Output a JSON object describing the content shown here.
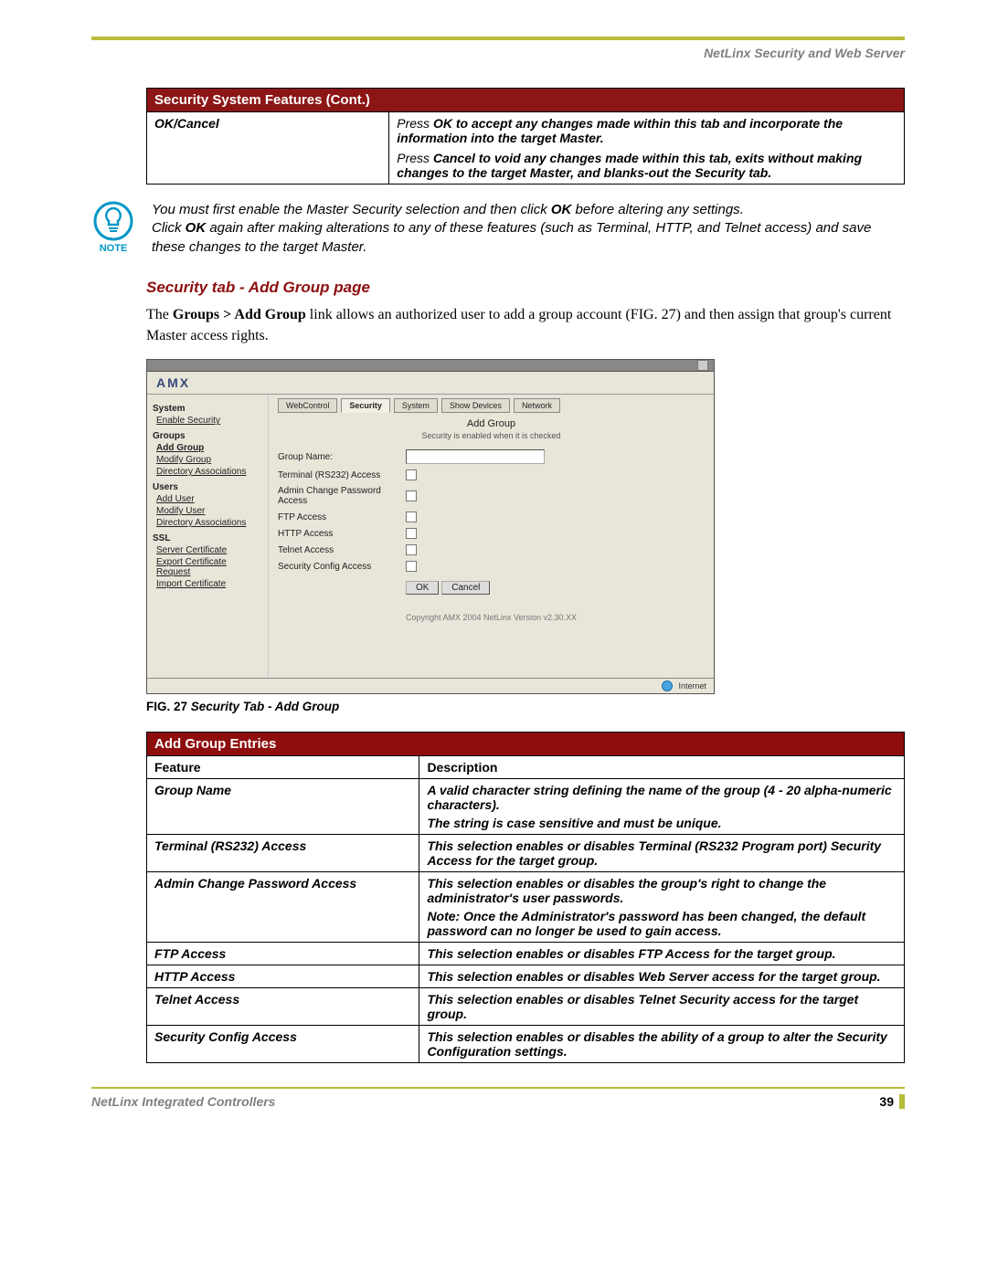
{
  "header": {
    "title": "NetLinx Security and Web Server"
  },
  "table1": {
    "title": "Security System Features (Cont.)",
    "row_label": "OK/Cancel",
    "desc1_prefix": "Press ",
    "desc1_bold": "OK",
    "desc1_rest": " to accept any changes made within this tab and incorporate the information into the target Master.",
    "desc2_prefix": "Press ",
    "desc2_bold": "Cancel",
    "desc2_rest": " to void any changes made within this tab, exits without making changes to the target Master, and blanks-out the Security tab."
  },
  "note": {
    "label": "NOTE",
    "line1a": "You must first enable the Master Security selection and then click ",
    "line1b": "OK",
    "line1c": " before altering any settings.",
    "line2a": "Click ",
    "line2b": "OK",
    "line2c": " again after making alterations to any of these features (such as Terminal, HTTP, and Telnet access) and save these changes to the target Master."
  },
  "subhead": "Security tab - Add Group page",
  "para": {
    "a": "The ",
    "b": "Groups > Add Group",
    "c": " link allows an authorized user to add a group account (FIG. 27) and then assign that group's current Master access rights."
  },
  "shot": {
    "logo": "AMX",
    "tabs": [
      "WebControl",
      "Security",
      "System",
      "Show Devices",
      "Network"
    ],
    "side": {
      "s_system": "System",
      "s_enable": "Enable Security",
      "s_groups": "Groups",
      "s_addg": "Add Group",
      "s_modg": "Modify Group",
      "s_dir1": "Directory Associations",
      "s_users": "Users",
      "s_addu": "Add User",
      "s_modu": "Modify User",
      "s_dir2": "Directory Associations",
      "s_ssl": "SSL",
      "s_sc": "Server Certificate",
      "s_ecr": "Export Certificate Request",
      "s_ic": "Import Certificate"
    },
    "main": {
      "title": "Add Group",
      "sub": "Security is enabled when it is checked",
      "rows": [
        "Group Name:",
        "Terminal (RS232) Access",
        "Admin Change Password Access",
        "FTP Access",
        "HTTP Access",
        "Telnet Access",
        "Security Config Access"
      ],
      "ok": "OK",
      "cancel": "Cancel",
      "copy": "Copyright AMX 2004   NetLinx Version v2.30.XX"
    },
    "status": "Internet"
  },
  "figcap": {
    "a": "FIG. 27",
    "b": "  Security Tab - Add Group"
  },
  "table2": {
    "title": "Add Group Entries",
    "h1": "Feature",
    "h2": "Description",
    "rows": [
      {
        "f": "Group Name",
        "d": "A valid character string defining the name of the group (4 - 20 alpha-numeric characters).",
        "d2": "The string is case sensitive and must be unique."
      },
      {
        "f": "Terminal (RS232) Access",
        "d": "This selection enables or disables Terminal (RS232 Program port) Security Access for the target group."
      },
      {
        "f": "Admin Change Password Access",
        "d": "This selection enables or disables the group's right to change the administrator's user passwords.",
        "d2": "Note: Once the Administrator's password has been changed, the default password can no longer be used to gain access."
      },
      {
        "f": "FTP Access",
        "d": "This selection enables or disables FTP Access for the target group."
      },
      {
        "f": "HTTP Access",
        "d": "This selection enables or disables Web Server access for the target group."
      },
      {
        "f": "Telnet Access",
        "d": "This selection enables or disables Telnet Security access for the target group."
      },
      {
        "f": "Security Config Access",
        "d": "This selection enables or disables the ability of a group to alter the Security Configuration settings."
      }
    ]
  },
  "footer": {
    "left": "NetLinx Integrated Controllers",
    "right": "39"
  }
}
